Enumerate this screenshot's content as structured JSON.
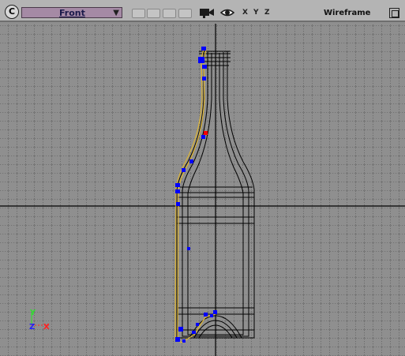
{
  "toolbar": {
    "menu_glyph": "C",
    "view_name": "Front",
    "dropdown_arrow": "▼",
    "axis_x": "X",
    "axis_y": "Y",
    "axis_z": "Z",
    "shading_mode": "Wireframe"
  },
  "icons": {
    "menu": "menu-circle-icon",
    "camera": "camera-icon",
    "eye": "eye-icon",
    "maximize": "maximize-icon"
  },
  "viewport": {
    "object": "bottle-wireframe",
    "gizmo": {
      "y": "Y",
      "z": "Z",
      "x": "X"
    }
  },
  "colors": {
    "background": "#8f8f8f",
    "grid": "#1a1a1a",
    "wire": "#000000",
    "profile": "#d8b23a",
    "control_points": "#0000ff",
    "selected_point": "#ff0000",
    "view_select": "#a58aa5",
    "gizmo_y": "#33dd33",
    "gizmo_z": "#2222ff",
    "gizmo_x": "#ff2222"
  }
}
